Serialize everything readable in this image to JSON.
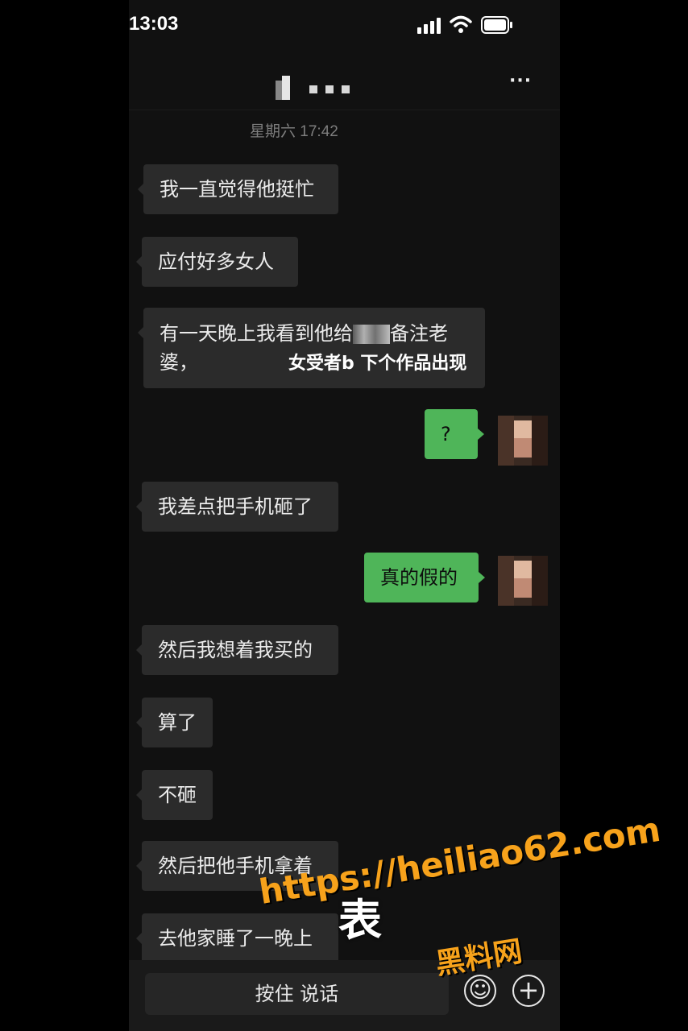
{
  "status_bar": {
    "time": "13:03"
  },
  "nav": {
    "title_obscured": "▮ • • •",
    "more_label": "···"
  },
  "timestamp": "星期六 17:42",
  "messages": [
    {
      "side": "left",
      "text": "我一直觉得他挺忙"
    },
    {
      "side": "left",
      "text": "应付好多女人"
    },
    {
      "side": "left",
      "line1": "有一天晚上我看到他给",
      "line1b": "备注老",
      "line2": "婆，",
      "overlay": "女受者b 下个作品出现"
    },
    {
      "side": "right",
      "text": "?"
    },
    {
      "side": "left",
      "text": "我差点把手机砸了"
    },
    {
      "side": "right",
      "text": "真的假的"
    },
    {
      "side": "left",
      "text": "然后我想着我买的"
    },
    {
      "side": "left",
      "text": "算了"
    },
    {
      "side": "left",
      "text": "不砸"
    },
    {
      "side": "left",
      "text": "然后把他手机拿着"
    },
    {
      "side": "left",
      "text": "去他家睡了一晚上"
    }
  ],
  "input_bar": {
    "hold_to_talk": "按住 说话",
    "emoji_icon": "☺",
    "plus_icon": "+"
  },
  "watermark": {
    "url": "https://heiliao62.com",
    "brand": "黑料网",
    "big_char": "表"
  },
  "colors": {
    "background": "#111111",
    "bubble_left": "#2b2b2b",
    "bubble_right": "#4fb559",
    "watermark": "#f7a21b"
  }
}
